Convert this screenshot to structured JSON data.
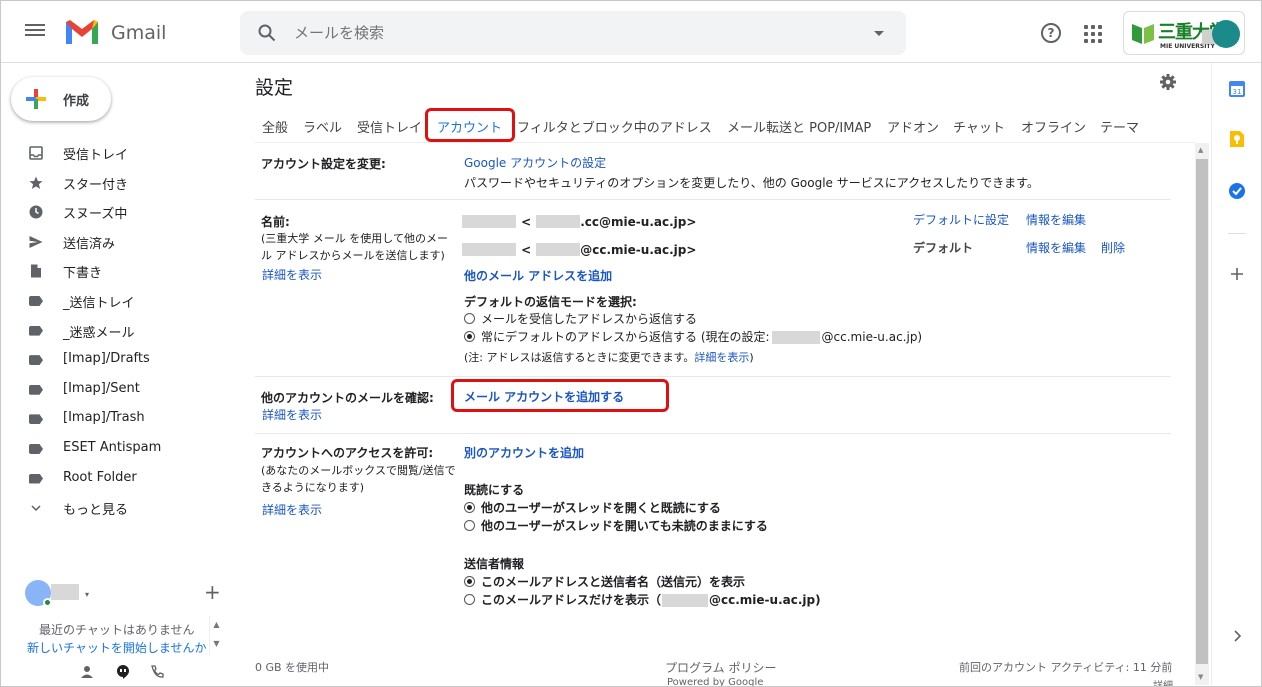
{
  "header": {
    "app_name": "Gmail",
    "search_placeholder": "メールを検索",
    "help_glyph": "?",
    "university_kanji": "三重大学",
    "university_en": "MIE UNIVERSITY"
  },
  "sidebar": {
    "compose_label": "作成",
    "items": [
      {
        "label": "受信トレイ",
        "icon": "inbox-icon"
      },
      {
        "label": "スター付き",
        "icon": "star-icon"
      },
      {
        "label": "スヌーズ中",
        "icon": "clock-icon"
      },
      {
        "label": "送信済み",
        "icon": "send-icon"
      },
      {
        "label": "下書き",
        "icon": "draft-icon"
      },
      {
        "label": "_送信トレイ",
        "icon": "label-icon"
      },
      {
        "label": "_迷惑メール",
        "icon": "label-icon"
      },
      {
        "label": "[Imap]/Drafts",
        "icon": "label-icon"
      },
      {
        "label": "[Imap]/Sent",
        "icon": "label-icon"
      },
      {
        "label": "[Imap]/Trash",
        "icon": "label-icon"
      },
      {
        "label": "ESET Antispam",
        "icon": "label-icon"
      },
      {
        "label": "Root Folder",
        "icon": "label-icon"
      },
      {
        "label": "もっと見る",
        "icon": "chevron-down-icon"
      }
    ],
    "chat": {
      "no_recent": "最近のチャットはありません",
      "start_new": "新しいチャットを開始しませんか"
    }
  },
  "main": {
    "title": "設定",
    "tabs": [
      "全般",
      "ラベル",
      "受信トレイ",
      "アカウント",
      "フィルタとブロック中のアドレス",
      "メール転送と POP/IMAP",
      "アドオン",
      "チャット",
      "オフライン",
      "テーマ"
    ],
    "active_tab": "アカウント",
    "account_change": {
      "label": "アカウント設定を変更:",
      "link": "Google アカウントの設定",
      "desc": "パスワードやセキュリティのオプションを変更したり、他の Google サービスにアクセスしたりできます。"
    },
    "name": {
      "label": "名前:",
      "sub_line1": "(三重大学 メール を使用して他のメー",
      "sub_line2": "ル アドレスからメールを送信します)",
      "detail_link": "詳細を表示",
      "addr1_lt": "<",
      "addr1_suffix": ".cc@mie-u.ac.jp>",
      "addr2_lt": "<",
      "addr2_suffix": "@cc.mie-u.ac.jp>",
      "set_default": "デフォルトに設定",
      "edit_info1": "情報を編集",
      "default_label": "デフォルト",
      "edit_info2": "情報を編集",
      "delete": "削除",
      "add_address": "他のメール アドレスを追加",
      "reply_mode_title": "デフォルトの返信モードを選択:",
      "reply_opt1": "メールを受信したアドレスから返信する",
      "reply_opt2_prefix": "常にデフォルトのアドレスから返信する (現在の設定:",
      "reply_opt2_suffix": "@cc.mie-u.ac.jp)",
      "note_prefix": "(注: アドレスは返信するときに変更できます。",
      "note_link": "詳細を表示",
      "note_suffix": ")"
    },
    "check_mail": {
      "label": "他のアカウントのメールを確認:",
      "detail_link": "詳細を表示",
      "add_account": "メール アカウントを追加する"
    },
    "grant_access": {
      "label": "アカウントへのアクセスを許可:",
      "sub_line1": "(あなたのメールボックスで閲覧/送信で",
      "sub_line2": "きるようになります)",
      "detail_link": "詳細を表示",
      "add_other": "別のアカウントを追加",
      "read_title": "既読にする",
      "read_opt1": "他のユーザーがスレッドを開くと既読にする",
      "read_opt2": "他のユーザーがスレッドを開いても未読のままにする",
      "sender_title": "送信者情報",
      "sender_opt1": "このメールアドレスと送信者名（送信元）を表示",
      "sender_opt2_prefix": "このメールアドレスだけを表示（",
      "sender_opt2_suffix": "@cc.mie-u.ac.jp)"
    },
    "footer": {
      "usage": "0 GB を使用中",
      "policy": "プログラム ポリシー",
      "powered": "Powered by Google",
      "activity": "前回のアカウント アクティビティ: 11 分前",
      "details": "詳細"
    }
  },
  "colors": {
    "accent": "#1a73e8",
    "highlight": "#e01010",
    "link": "#1a56c4"
  }
}
